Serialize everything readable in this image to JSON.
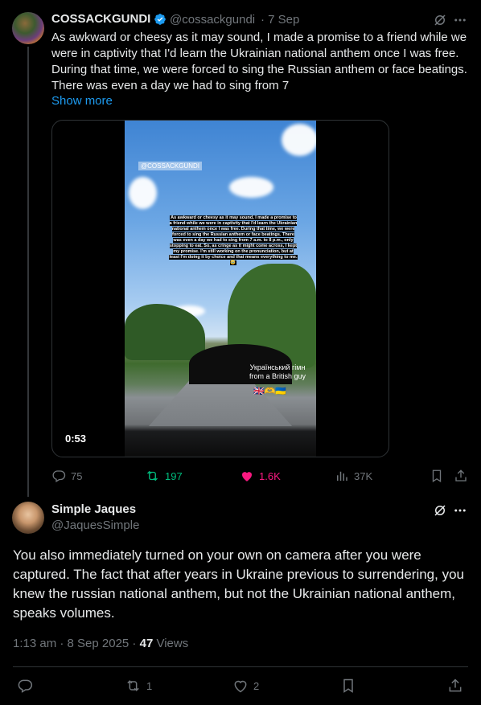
{
  "tweet": {
    "author_name": "COSSACKGUNDI",
    "author_handle": "@cossackgundi",
    "date": "· 7 Sep",
    "text": "As awkward or cheesy as it may sound, I made a promise to a friend while we were in captivity that I'd learn the Ukrainian national anthem once I was free. During that time, we were forced to sing the Russian anthem or face beatings. There was even a day we had to sing from 7",
    "show_more": "Show more",
    "video": {
      "watermark": "@COSSACKGUNDI",
      "caption": "As awkward or cheesy as it may sound, I made a promise to a friend while we were in captivity that I'd learn the Ukrainian national anthem once I was free. During that time, we were forced to sing the Russian anthem or face beatings. There was even a day we had to sing from 7 a.m. to 8 p.m., only stopping to eat. So, as cringe as it might come across, I kept my promise. I'm still working on the pronunciation, but at least I'm doing it by choice and that means everything to me.🥹",
      "overlay_text": "Український гімн from a British guy",
      "flags": "🇬🇧🫶🇺🇦",
      "duration": "0:53"
    },
    "stats": {
      "replies": "75",
      "reposts": "197",
      "likes": "1.6K",
      "views": "37K"
    }
  },
  "reply": {
    "author_name": "Simple Jaques",
    "author_handle": "@JaquesSimple",
    "text": "You also immediately turned on your own on camera after you were captured. The fact that after years in Ukraine previous to surrendering, you knew the russian national anthem, but not the Ukrainian national anthem, speaks volumes.",
    "timestamp": "1:13 am · 8 Sep 2025 · ",
    "views_count": "47",
    "views_label": " Views",
    "stats": {
      "reposts": "1",
      "likes": "2"
    }
  },
  "colors": {
    "accent": "#1d9bf0",
    "repost_active": "#00ba7c",
    "like_active": "#f91880",
    "muted": "#71767b"
  }
}
